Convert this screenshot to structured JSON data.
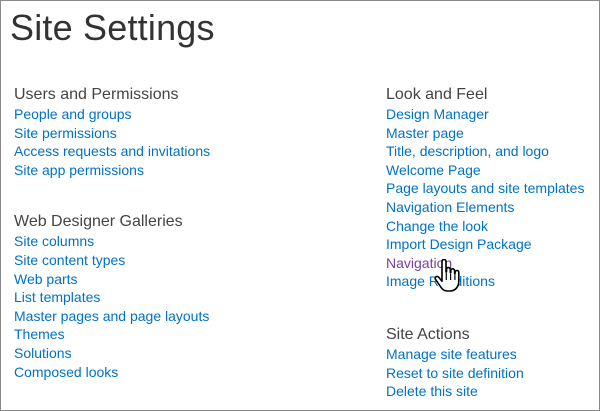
{
  "page": {
    "title": "Site Settings"
  },
  "left_column": {
    "sections": [
      {
        "heading": "Users and Permissions",
        "links": [
          "People and groups",
          "Site permissions",
          "Access requests and invitations",
          "Site app permissions"
        ]
      },
      {
        "heading": "Web Designer Galleries",
        "links": [
          "Site columns",
          "Site content types",
          "Web parts",
          "List templates",
          "Master pages and page layouts",
          "Themes",
          "Solutions",
          "Composed looks"
        ]
      }
    ]
  },
  "right_column": {
    "sections": [
      {
        "heading": "Look and Feel",
        "links": [
          "Design Manager",
          "Master page",
          "Title, description, and logo",
          "Welcome Page",
          "Page layouts and site templates",
          "Navigation Elements",
          "Change the look",
          "Import Design Package",
          "Navigation",
          "Image Renditions"
        ]
      },
      {
        "heading": "Site Actions",
        "links": [
          "Manage site features",
          "Reset to site definition",
          "Delete this site"
        ]
      }
    ]
  },
  "state": {
    "hovered_link": "Navigation"
  },
  "colors": {
    "link": "#0072c6",
    "link_hover": "#7b3fa0",
    "heading": "#444444",
    "title": "#333333"
  },
  "icons": {
    "cursor": "hand-pointer-icon"
  }
}
